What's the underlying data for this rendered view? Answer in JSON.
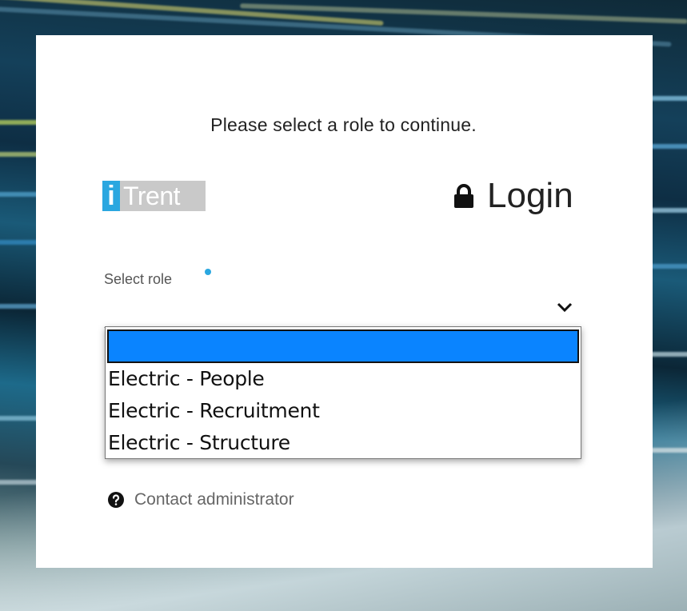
{
  "prompt": "Please select a role to continue.",
  "logo": {
    "i": "i",
    "trent": "Trent"
  },
  "login_title": "Login",
  "role_field": {
    "label": "Select role",
    "selected": "",
    "options": [
      "",
      "Electric - People",
      "Electric - Recruitment",
      "Electric - Structure"
    ]
  },
  "help_link": "Contact administrator",
  "colors": {
    "accent": "#2aa7e0",
    "selected_option": "#0a84ff"
  },
  "icons": {
    "lock": "lock-icon",
    "dropdown": "chevron-down-icon",
    "help": "question-circle-icon"
  }
}
